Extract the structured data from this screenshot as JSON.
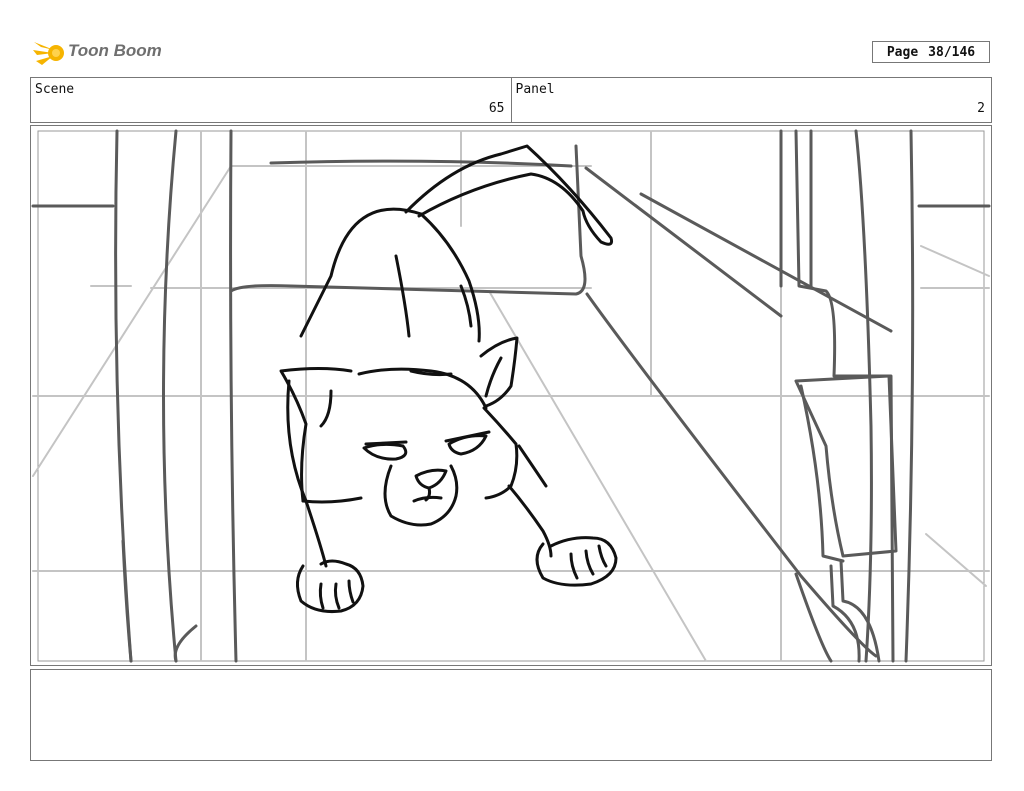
{
  "header": {
    "brand": "Toon Boom",
    "page_label": "Page",
    "page_value": "38/146"
  },
  "info": {
    "scene_label": "Scene",
    "scene_value": "65",
    "panel_label": "Panel",
    "panel_value": "2"
  },
  "icons": {
    "logo": "toon-boom-logo-icon"
  },
  "colors": {
    "logo_accent": "#f6b400"
  }
}
